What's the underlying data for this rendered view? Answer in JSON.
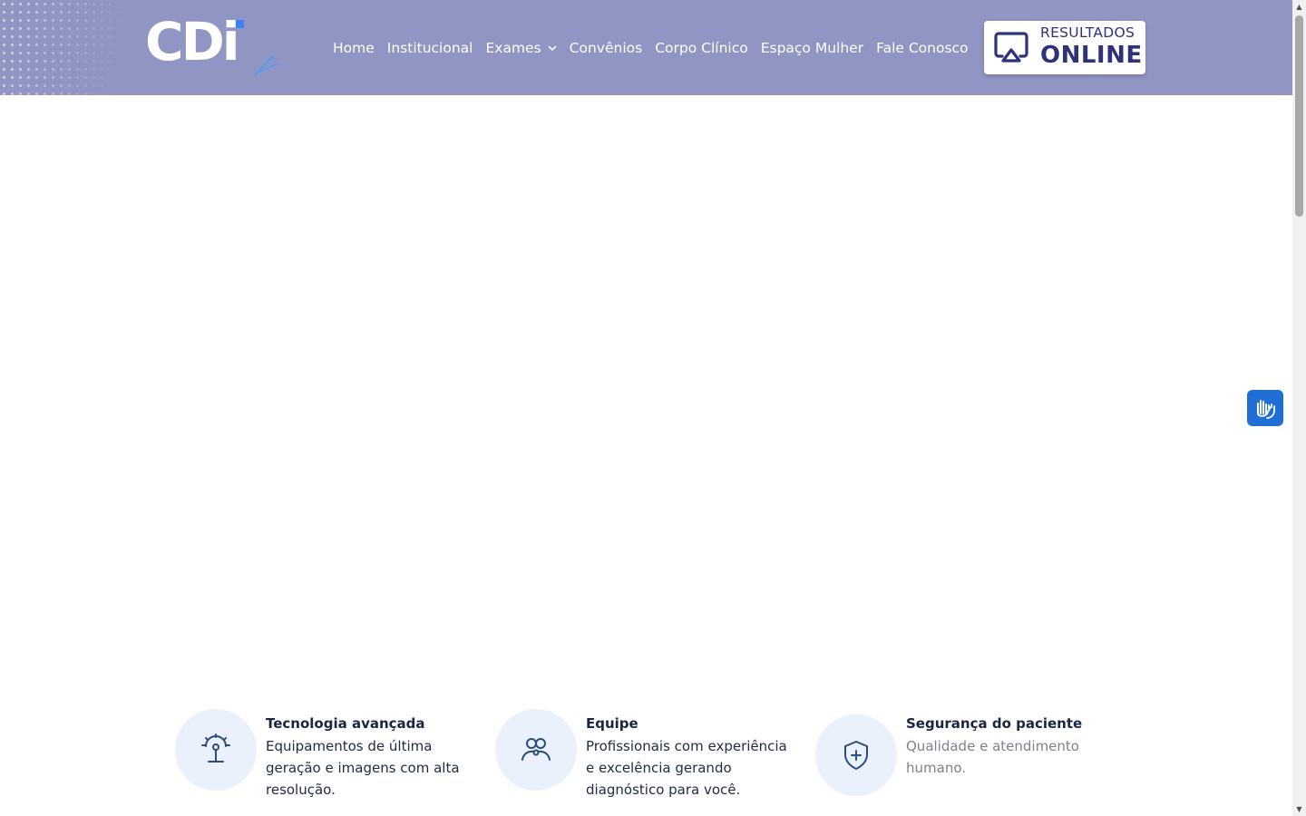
{
  "header": {
    "logo_text": "CDi",
    "nav": [
      {
        "label": "Home"
      },
      {
        "label": "Institucional"
      },
      {
        "label": "Exames",
        "has_dropdown": true
      },
      {
        "label": "Convênios"
      },
      {
        "label": "Corpo Clínico"
      },
      {
        "label": "Espaço Mulher"
      },
      {
        "label": "Fale Conosco"
      }
    ],
    "results_button": {
      "line1": "RESULTADOS",
      "line2": "ONLINE",
      "icon": "monitor-share-icon"
    }
  },
  "accessibility": {
    "icon": "sign-language-hands-icon"
  },
  "features": [
    {
      "icon": "medical-equipment-icon",
      "title": "Tecnologia avançada",
      "description": "Equipamentos de última geração e imagens com alta resolução.",
      "muted": false
    },
    {
      "icon": "team-people-icon",
      "title": "Equipe",
      "description": "Profissionais com experiência e excelência gerando diagnóstico para você.",
      "muted": false
    },
    {
      "icon": "shield-plus-icon",
      "title": "Segurança do paciente",
      "description": "Qualidade e atendimento humano.",
      "muted": true
    }
  ],
  "colors": {
    "header_bg": "#9095c3",
    "brand_dark": "#2d327a",
    "icon_circle_bg": "#eaf1fc",
    "icon_stroke": "#2b4d7e",
    "a11y_bg": "#1f6fd6"
  }
}
